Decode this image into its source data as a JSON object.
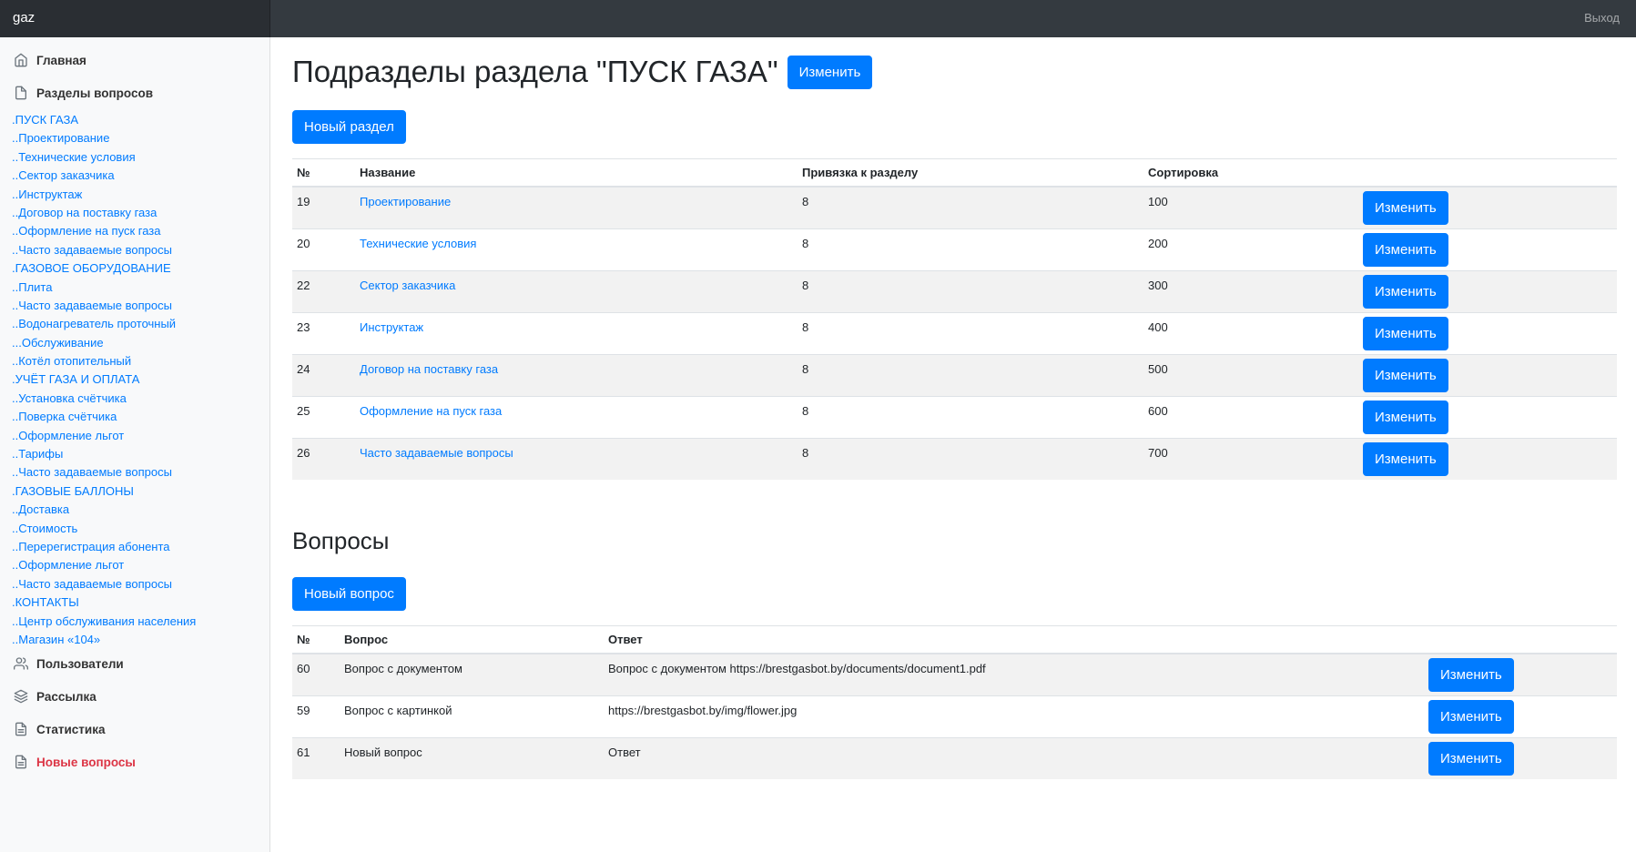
{
  "navbar": {
    "brand": "gaz",
    "logout": "Выход"
  },
  "sidebar": {
    "main_items": [
      {
        "label": "Главная",
        "icon": "home-icon"
      },
      {
        "label": "Разделы вопросов",
        "icon": "file-icon"
      },
      {
        "label": "Пользователи",
        "icon": "users-icon"
      },
      {
        "label": "Рассылка",
        "icon": "layers-icon"
      },
      {
        "label": "Статистика",
        "icon": "file-text-icon"
      },
      {
        "label": "Новые вопросы",
        "icon": "file-text-icon",
        "color": "#dc3545"
      }
    ],
    "sections": [
      ".ПУСК ГАЗА",
      "..Проектирование",
      "..Технические условия",
      "..Сектор заказчика",
      "..Инструктаж",
      "..Договор на поставку газа",
      "..Оформление на пуск газа",
      "..Часто задаваемые вопросы",
      ".ГАЗОВОЕ ОБОРУДОВАНИЕ",
      "..Плита",
      "..Часто задаваемые вопросы",
      "..Водонагреватель проточный",
      "...Обслуживание",
      "..Котёл отопительный",
      ".УЧЁТ ГАЗА И ОПЛАТА",
      "..Установка счётчика",
      "..Поверка счётчика",
      "..Оформление льгот",
      "..Тарифы",
      "..Часто задаваемые вопросы",
      ".ГАЗОВЫЕ БАЛЛОНЫ",
      "..Доставка",
      "..Стоимость",
      "..Перерегистрация абонента",
      "..Оформление льгот",
      "..Часто задаваемые вопросы",
      ".КОНТАКТЫ",
      "..Центр обслуживания населения",
      "..Магазин «104»"
    ]
  },
  "main": {
    "title": "Подразделы раздела \"ПУСК ГАЗА\"",
    "edit_label": "Изменить",
    "new_section_label": "Новый раздел",
    "subsections": {
      "headers": [
        "№",
        "Название",
        "Привязка к разделу",
        "Сортировка"
      ],
      "rows": [
        {
          "id": "19",
          "name": "Проектирование",
          "parent": "8",
          "sort": "100"
        },
        {
          "id": "20",
          "name": "Технические условия",
          "parent": "8",
          "sort": "200"
        },
        {
          "id": "22",
          "name": "Сектор заказчика",
          "parent": "8",
          "sort": "300"
        },
        {
          "id": "23",
          "name": "Инструктаж",
          "parent": "8",
          "sort": "400"
        },
        {
          "id": "24",
          "name": "Договор на поставку газа",
          "parent": "8",
          "sort": "500"
        },
        {
          "id": "25",
          "name": "Оформление на пуск газа",
          "parent": "8",
          "sort": "600"
        },
        {
          "id": "26",
          "name": "Часто задаваемые вопросы",
          "parent": "8",
          "sort": "700"
        }
      ]
    },
    "questions_title": "Вопросы",
    "new_question_label": "Новый вопрос",
    "questions": {
      "headers": [
        "№",
        "Вопрос",
        "Ответ"
      ],
      "rows": [
        {
          "id": "60",
          "question": "Вопрос с документом",
          "answer": "Вопрос с документом https://brestgasbot.by/documents/document1.pdf"
        },
        {
          "id": "59",
          "question": "Вопрос с картинкой",
          "answer": "https://brestgasbot.by/img/flower.jpg"
        },
        {
          "id": "61",
          "question": "Новый вопрос",
          "answer": "Ответ"
        }
      ]
    }
  },
  "colors": {
    "primary": "#007bff",
    "navbar": "#343a40",
    "danger": "#dc3545",
    "sidebar": "#f8f9fa"
  }
}
